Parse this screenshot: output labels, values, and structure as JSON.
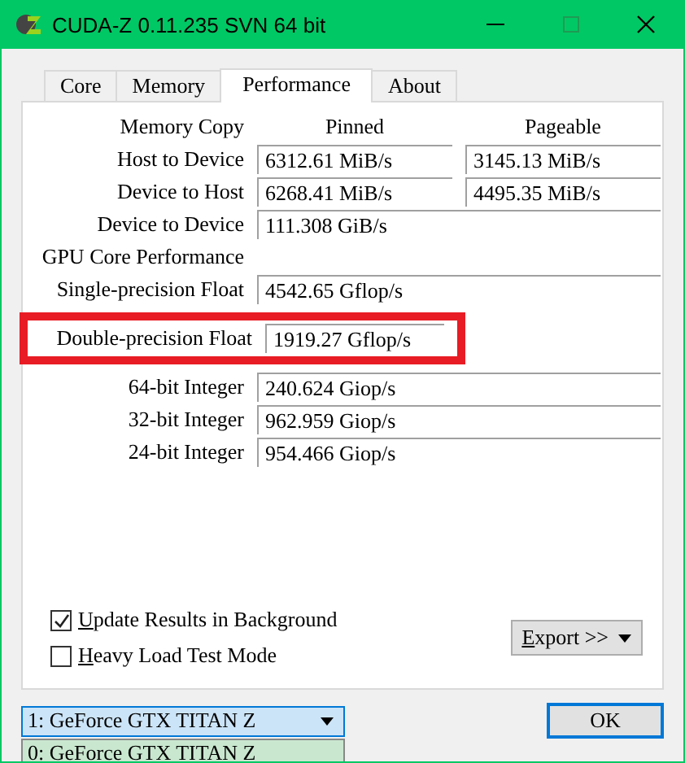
{
  "window": {
    "title": "CUDA-Z 0.11.235 SVN 64 bit"
  },
  "tabs": [
    {
      "label": "Core",
      "selected": false
    },
    {
      "label": "Memory",
      "selected": false
    },
    {
      "label": "Performance",
      "selected": true
    },
    {
      "label": "About",
      "selected": false
    }
  ],
  "memory_copy": {
    "label": "Memory Copy",
    "columns": [
      "Pinned",
      "Pageable"
    ],
    "rows": [
      {
        "label": "Host to Device",
        "values": [
          "6312.61 MiB/s",
          "3145.13 MiB/s"
        ]
      },
      {
        "label": "Device to Host",
        "values": [
          "6268.41 MiB/s",
          "4495.35 MiB/s"
        ]
      },
      {
        "label": "Device to Device",
        "values": [
          "111.308 GiB/s"
        ]
      }
    ]
  },
  "gpu_core": {
    "label": "GPU Core Performance",
    "rows": [
      {
        "label": "Single-precision Float",
        "value": "4542.65 Gflop/s",
        "highlighted": false
      },
      {
        "label": "Double-precision Float",
        "value": "1919.27 Gflop/s",
        "highlighted": true
      },
      {
        "label": "64-bit Integer",
        "value": "240.624 Giop/s",
        "highlighted": false
      },
      {
        "label": "32-bit Integer",
        "value": "962.959 Giop/s",
        "highlighted": false
      },
      {
        "label": "24-bit Integer",
        "value": "954.466 Giop/s",
        "highlighted": false
      }
    ]
  },
  "options": [
    {
      "label": "Update Results in Background",
      "checked": true
    },
    {
      "label": "Heavy Load Test Mode",
      "checked": false
    }
  ],
  "export_button": {
    "label": "Export >>"
  },
  "device_select": {
    "value": "1: GeForce GTX TITAN Z",
    "options": [
      {
        "label": "0: GeForce GTX TITAN Z",
        "selected": true
      }
    ]
  },
  "ok_button": {
    "label": "OK"
  }
}
